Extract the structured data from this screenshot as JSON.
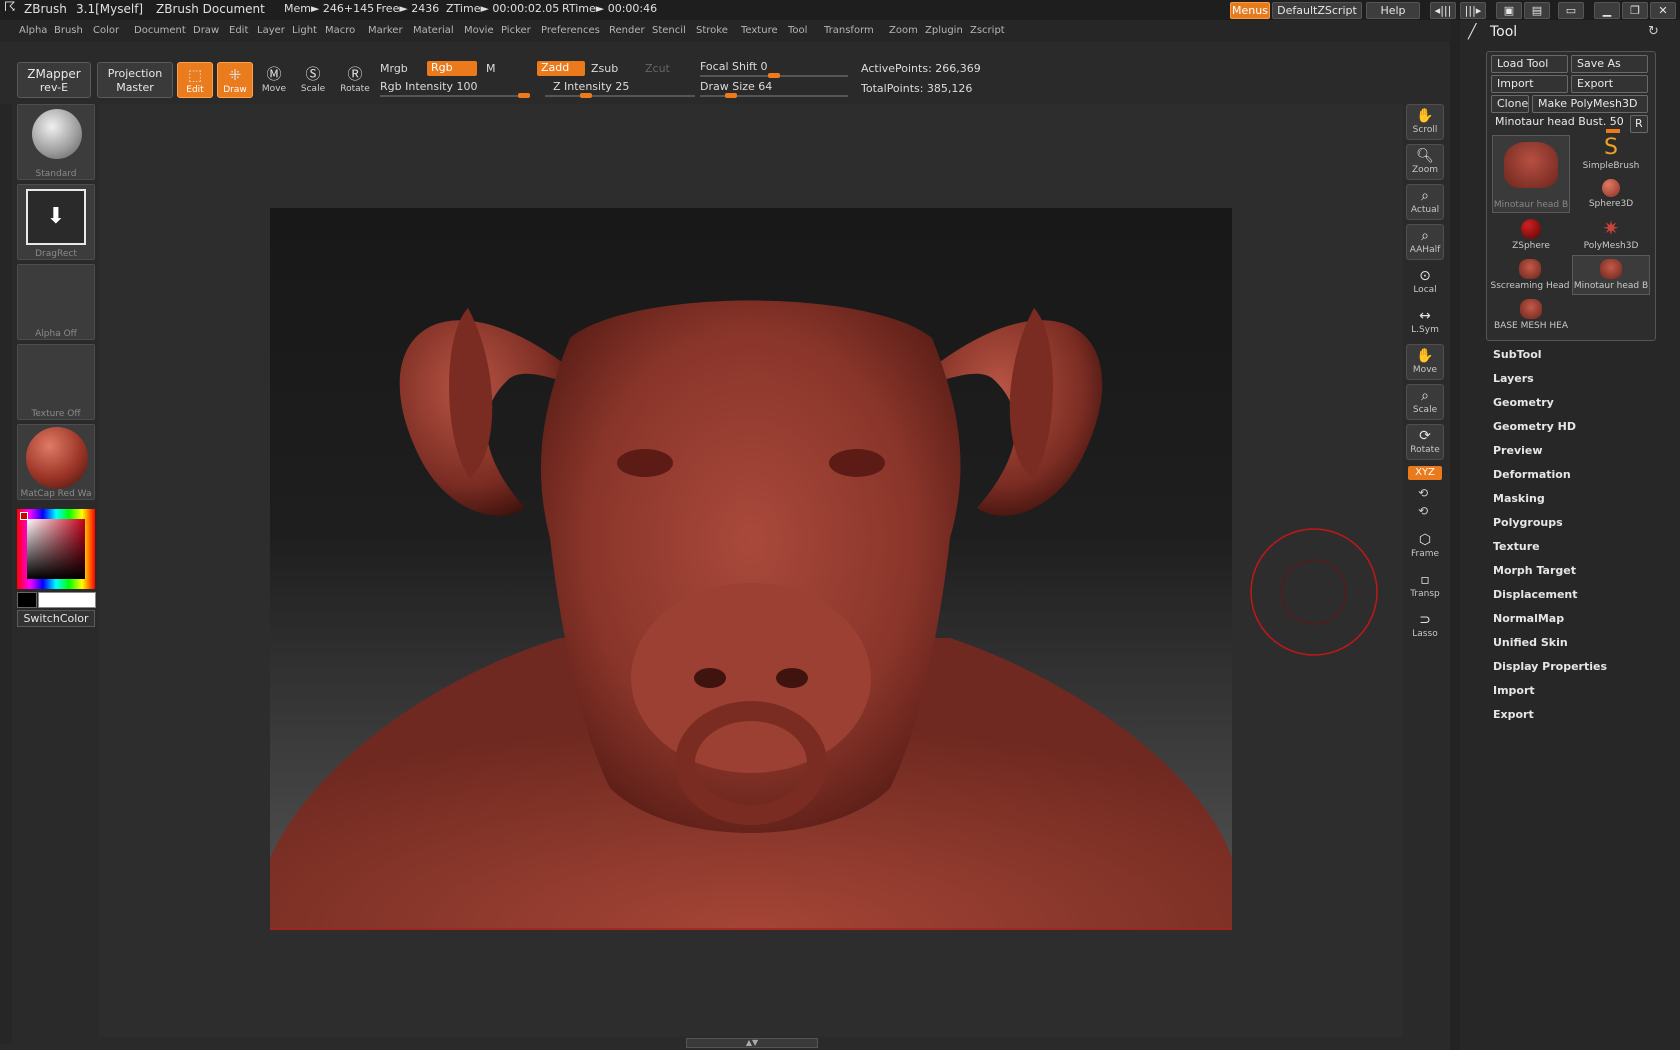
{
  "titlebar": {
    "app": "ZBrush",
    "version": "3.1[Myself]",
    "document": "ZBrush Document",
    "mem": "Mem► 246+145",
    "free": "Free► 2436",
    "ztime": "ZTime► 00:00:02.05",
    "rtime": "RTime► 00:00:46",
    "menus_btn": "Menus",
    "script_btn": "DefaultZScript",
    "help_btn": "Help"
  },
  "menubar": [
    "Alpha",
    "Brush",
    "Color",
    "Document",
    "Draw",
    "Edit",
    "Layer",
    "Light",
    "Macro",
    "Marker",
    "Material",
    "Movie",
    "Picker",
    "Preferences",
    "Render",
    "Stencil",
    "Stroke",
    "Texture",
    "Tool",
    "Transform",
    "Zoom",
    "Zplugin",
    "Zscript"
  ],
  "shelf": {
    "zmapper_l1": "ZMapper",
    "zmapper_l2": "rev-E",
    "projection_l1": "Projection",
    "projection_l2": "Master",
    "tools": [
      "Edit",
      "Draw",
      "Move",
      "Scale",
      "Rotate"
    ],
    "mrgb": "Mrgb",
    "rgb": "Rgb",
    "m": "M",
    "rgb_intensity": "Rgb Intensity 100",
    "zadd": "Zadd",
    "zsub": "Zsub",
    "zcut": "Zcut",
    "z_intensity": "Z Intensity 25",
    "focal_shift": "Focal Shift 0",
    "draw_size": "Draw Size 64",
    "active_points": "ActivePoints: 266,369",
    "total_points": "TotalPoints: 385,126",
    "rgb_intensity_value": 100,
    "z_intensity_value": 25,
    "focal_shift_value": 0,
    "draw_size_value": 64
  },
  "lefttray": {
    "brush": "Standard",
    "stroke": "DragRect",
    "alpha": "Alpha Off",
    "texture": "Texture Off",
    "material": "MatCap Red Wa",
    "switch_color": "SwitchColor"
  },
  "navtools": [
    "Scroll",
    "Zoom",
    "Actual",
    "AAHalf",
    "Local",
    "L.Sym",
    "Move",
    "Scale",
    "Rotate",
    "XYZ",
    "Frame",
    "Transp",
    "Lasso"
  ],
  "palette": {
    "title": "Tool",
    "load_tool": "Load Tool",
    "save_as": "Save As",
    "import": "Import",
    "export": "Export",
    "clone": "Clone",
    "make_polymesh": "Make PolyMesh3D",
    "current_tool": "Minotaur head Bust. 50",
    "r_btn": "R",
    "tools": [
      {
        "label": "Minotaur head B"
      },
      {
        "label": "SimpleBrush"
      },
      {
        "label": "Sphere3D"
      },
      {
        "label": "ZSphere"
      },
      {
        "label": "PolyMesh3D"
      },
      {
        "label": "Sscreaming Head"
      },
      {
        "label": "Minotaur head B"
      },
      {
        "label": "BASE MESH HEA"
      }
    ],
    "sections": [
      "SubTool",
      "Layers",
      "Geometry",
      "Geometry HD",
      "Preview",
      "Deformation",
      "Masking",
      "Polygroups",
      "Texture",
      "Morph Target",
      "Displacement",
      "NormalMap",
      "Unified Skin",
      "Display Properties",
      "Import",
      "Export"
    ]
  },
  "colors": {
    "accent": "#ea7a1c",
    "sculpt": "#8e3a2e",
    "brush_cursor": "#c01818"
  }
}
